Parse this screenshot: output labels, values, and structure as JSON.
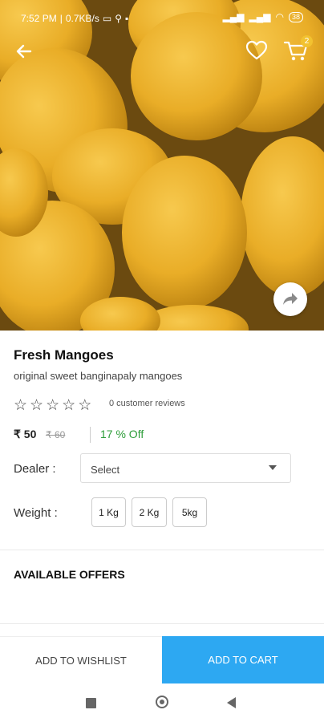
{
  "status": {
    "time": "7:52 PM",
    "speed": "0.7KB/s",
    "battery": "38"
  },
  "header": {
    "cart_count": "2"
  },
  "product": {
    "title": "Fresh Mangoes",
    "subtitle": "original sweet banginapaly mangoes",
    "rating": 0,
    "reviews": "0 customer reviews",
    "price": "₹ 50",
    "old_price": "₹ 60",
    "discount": "17 % Off"
  },
  "dealer": {
    "label": "Dealer :",
    "selected": "Select"
  },
  "weight": {
    "label": "Weight :",
    "options": [
      "1 Kg",
      "2 Kg",
      "5kg"
    ]
  },
  "offers": {
    "title": "AVAILABLE OFFERS"
  },
  "actions": {
    "wishlist": "ADD TO WISHLIST",
    "add_to_cart": "ADD TO CART"
  },
  "colors": {
    "accent": "#2da8f2",
    "discount": "#2e9d3a",
    "badge": "#f2c230"
  }
}
